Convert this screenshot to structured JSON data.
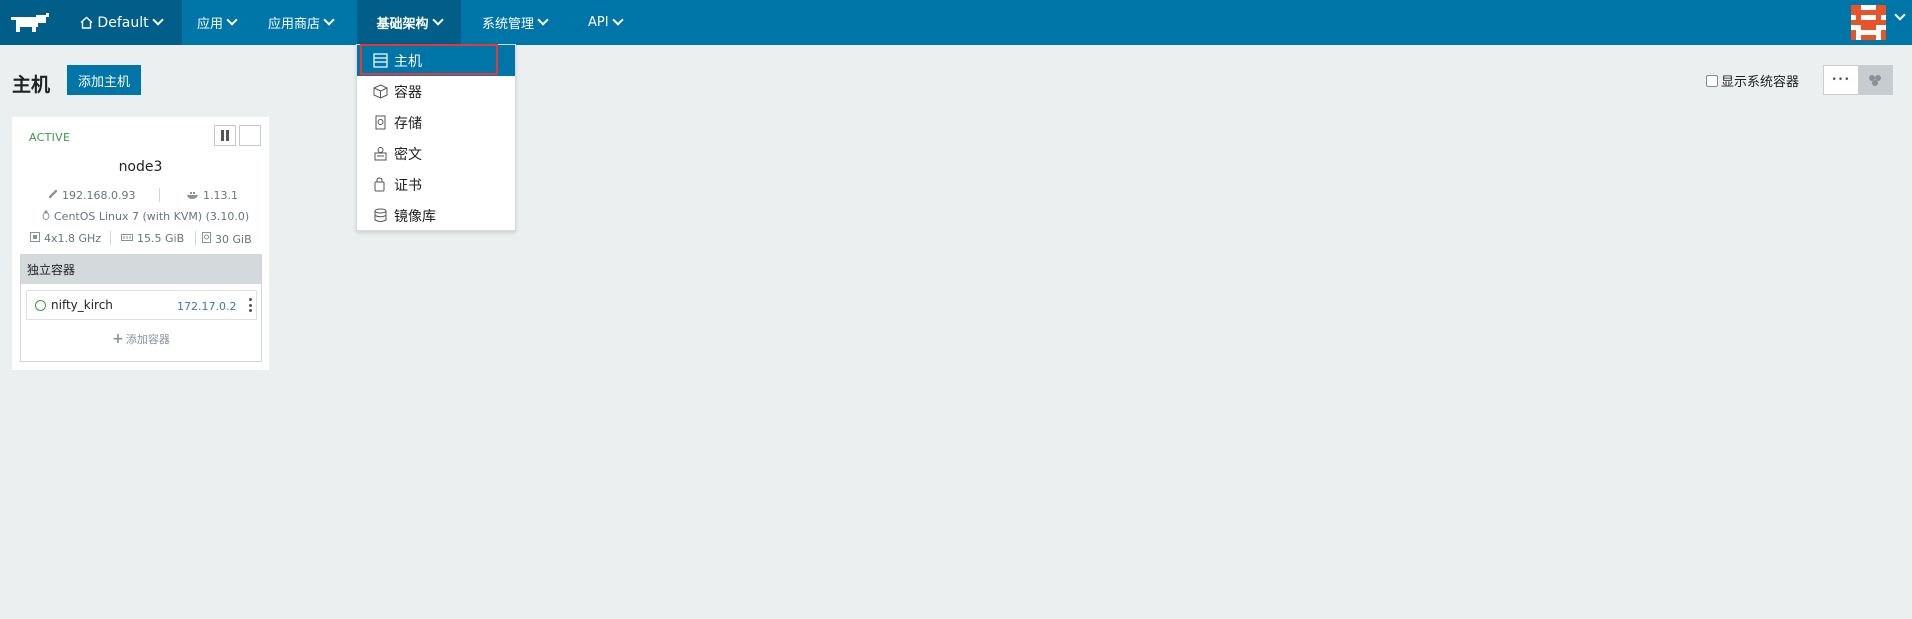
{
  "nav": {
    "environment": "Default",
    "items": [
      {
        "label": "应用"
      },
      {
        "label": "应用商店"
      },
      {
        "label": "基础架构"
      },
      {
        "label": "系统管理"
      },
      {
        "label": "API"
      }
    ]
  },
  "dropdown": {
    "items": [
      {
        "label": "主机",
        "icon": "host-icon",
        "selected": true
      },
      {
        "label": "容器",
        "icon": "cube-icon"
      },
      {
        "label": "存储",
        "icon": "storage-icon"
      },
      {
        "label": "密文",
        "icon": "secret-icon"
      },
      {
        "label": "证书",
        "icon": "certificate-icon"
      },
      {
        "label": "镜像库",
        "icon": "registry-icon"
      }
    ]
  },
  "page": {
    "title": "主机",
    "add_host_label": "添加主机",
    "show_system_label": "显示系统容器",
    "view_list_glyph": "•••"
  },
  "host": {
    "state": "ACTIVE",
    "name": "node3",
    "ip": "192.168.0.93",
    "docker_version": "1.13.1",
    "os": "CentOS Linux 7 (with KVM) (3.10.0)",
    "cpu": "4x1.8 GHz",
    "memory": "15.5 GiB",
    "disk": "30 GiB",
    "containers_header": "独立容器",
    "containers": [
      {
        "name": "nifty_kirch",
        "ip": "172.17.0.2"
      }
    ],
    "add_container_label": "添加容器"
  },
  "colors": {
    "navbar": "#0075a8",
    "navbar_dark": "#005e88",
    "active_green": "#3d9a42",
    "highlight_red": "#e53935"
  }
}
